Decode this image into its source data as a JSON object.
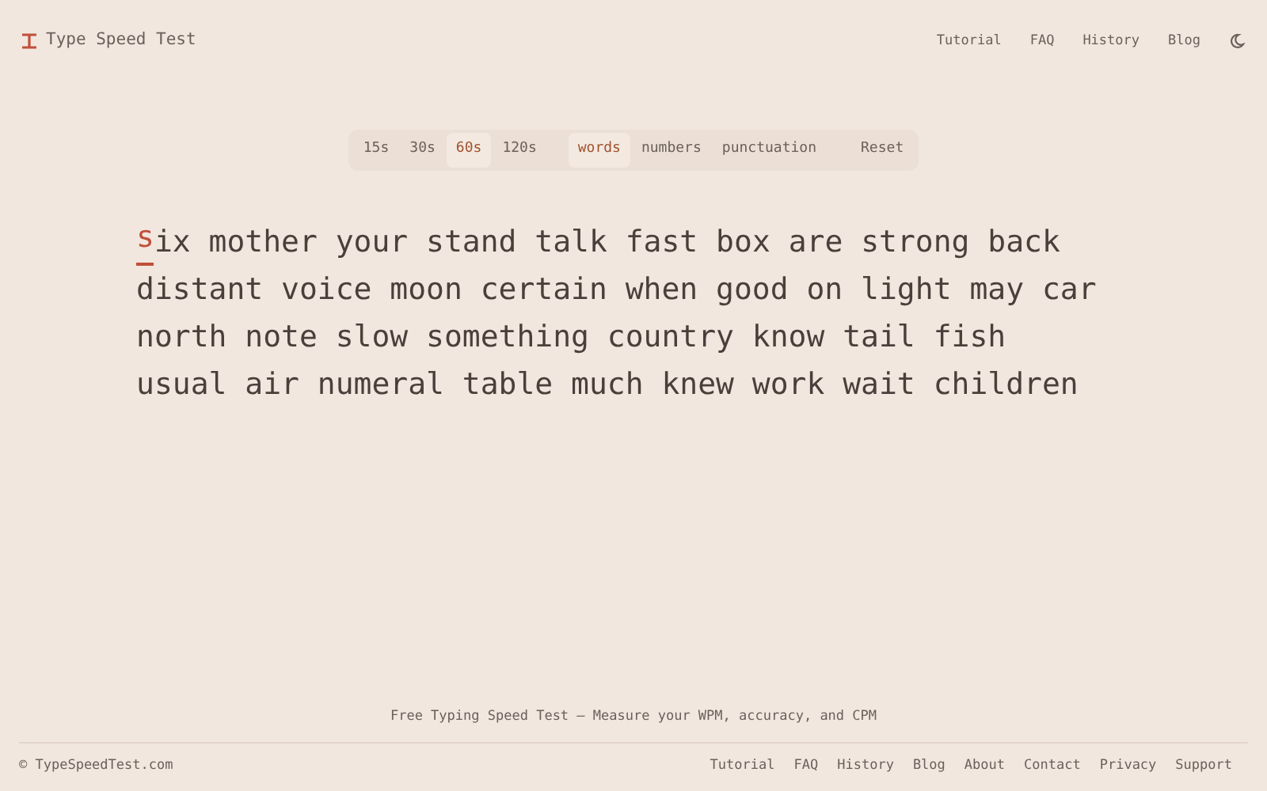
{
  "header": {
    "title": "Type Speed Test",
    "nav": [
      "Tutorial",
      "FAQ",
      "History",
      "Blog"
    ]
  },
  "mode_bar": {
    "durations": [
      {
        "label": "15s",
        "selected": false
      },
      {
        "label": "30s",
        "selected": false
      },
      {
        "label": "60s",
        "selected": true
      },
      {
        "label": "120s",
        "selected": false
      }
    ],
    "modes": [
      {
        "label": "words",
        "selected": true
      },
      {
        "label": "numbers",
        "selected": false
      },
      {
        "label": "punctuation",
        "selected": false
      }
    ],
    "reset": "Reset"
  },
  "test_text": {
    "lines": [
      {
        "active_letter": "s",
        "text": "ix mother your stand talk fast box are strong back"
      },
      {
        "text": "distant voice moon certain when good on light may car"
      },
      {
        "text": "north note slow something country know tail fish"
      },
      {
        "text": "usual air numeral table much knew work wait children"
      }
    ]
  },
  "footer": {
    "tagline": "Free Typing Speed Test – Measure your WPM, accuracy, and CPM",
    "copyright": "© TypeSpeedTest.com",
    "links": [
      "Tutorial",
      "FAQ",
      "History",
      "Blog",
      "About",
      "Contact",
      "Privacy",
      "Support"
    ]
  }
}
